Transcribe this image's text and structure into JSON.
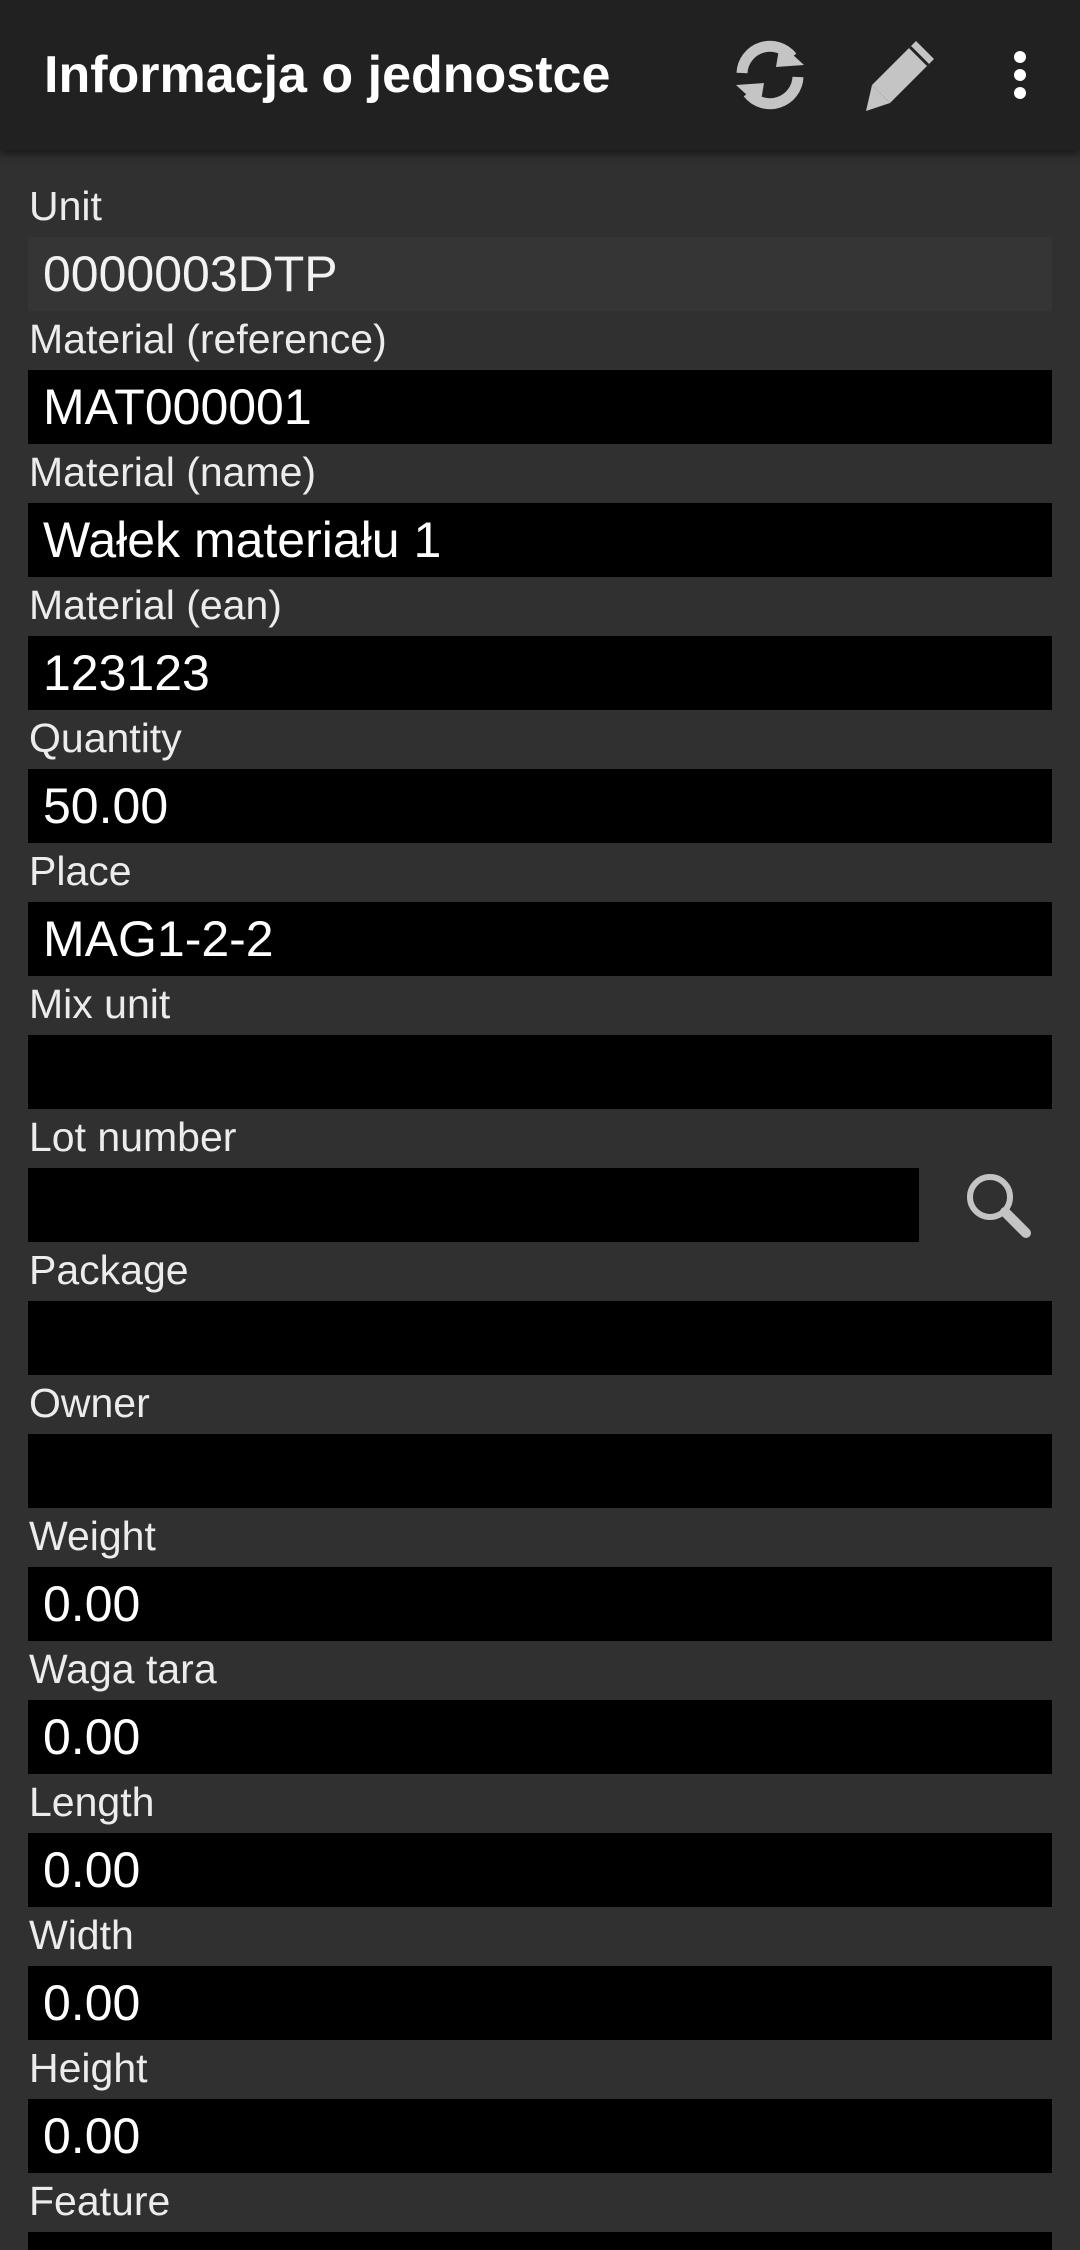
{
  "appbar": {
    "title": "Informacja o jednostce",
    "icons": [
      "refresh-icon",
      "pencil-icon",
      "overflow-menu-icon"
    ]
  },
  "colors": {
    "appbar_bg": "#212121",
    "page_bg": "#303030",
    "field_bg": "#000000",
    "readonly_field_bg": "#353535",
    "text": "#ffffff",
    "icon": "#c4c4c4"
  },
  "fields": [
    {
      "label": "Unit",
      "value": "0000003DTP"
    },
    {
      "label": "Material (reference)",
      "value": "MAT000001"
    },
    {
      "label": "Material (name)",
      "value": "Wałek materiału 1"
    },
    {
      "label": "Material (ean)",
      "value": "123123"
    },
    {
      "label": "Quantity",
      "value": "50.00"
    },
    {
      "label": "Place",
      "value": "MAG1-2-2"
    },
    {
      "label": "Mix unit",
      "value": ""
    },
    {
      "label": "Lot number",
      "value": "",
      "action_icon": "search-icon"
    },
    {
      "label": "Package",
      "value": ""
    },
    {
      "label": "Owner",
      "value": ""
    },
    {
      "label": "Weight",
      "value": "0.00"
    },
    {
      "label": "Waga tara",
      "value": "0.00"
    },
    {
      "label": "Length",
      "value": "0.00"
    },
    {
      "label": "Width",
      "value": "0.00"
    },
    {
      "label": "Height",
      "value": "0.00"
    },
    {
      "label": "Feature",
      "value": ""
    }
  ]
}
